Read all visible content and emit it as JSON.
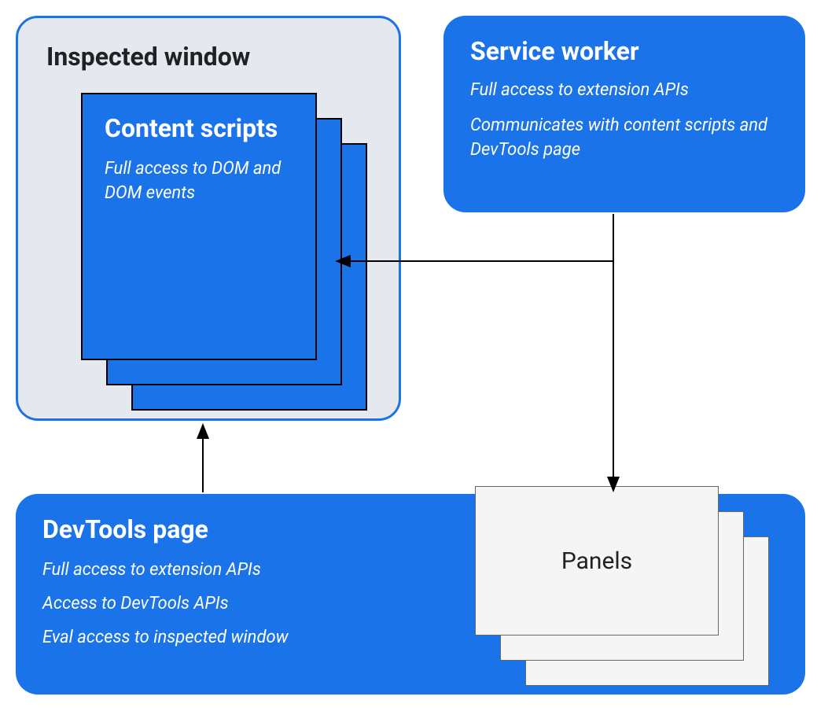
{
  "inspected_window": {
    "title": "Inspected window"
  },
  "content_scripts": {
    "title": "Content scripts",
    "description": "Full access to DOM and DOM events"
  },
  "service_worker": {
    "title": "Service worker",
    "desc1": "Full access to extension APIs",
    "desc2": "Communicates with content scripts and DevTools page"
  },
  "devtools_page": {
    "title": "DevTools page",
    "desc1": "Full access to extension APIs",
    "desc2": "Access to DevTools APIs",
    "desc3": "Eval access to inspected window"
  },
  "panels": {
    "title": "Panels"
  }
}
